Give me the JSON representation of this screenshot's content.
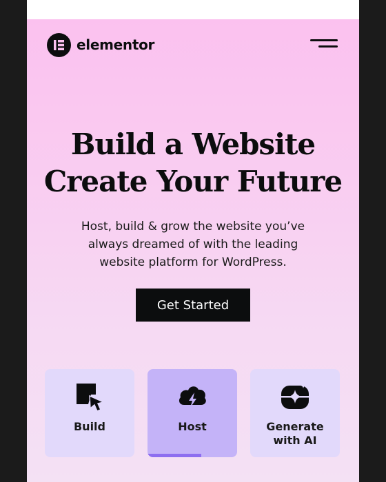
{
  "brand": {
    "name": "elementor",
    "logo_icon": "elementor-e-icon",
    "colors": {
      "hero_gradient_top": "#fbc1ef",
      "hero_gradient_bottom": "#f4e1f4",
      "card": "#e2d9fb",
      "card_active": "#c4b3f8",
      "progress": "#8d6ef0",
      "ink": "#0c0d0e"
    }
  },
  "header": {
    "menu_icon": "hamburger-menu-icon"
  },
  "hero": {
    "headline_line1": "Build a Website",
    "headline_line2": "Create Your Future",
    "subtext": "Host, build & grow the website you’ve always dreamed of with the leading website platform for WordPress.",
    "cta_label": "Get Started"
  },
  "features": [
    {
      "label": "Build",
      "icon": "build-cursor-icon",
      "active": false
    },
    {
      "label": "Host",
      "icon": "cloud-lightning-icon",
      "active": true,
      "progress": 0.6
    },
    {
      "label": "Generate with AI",
      "icon": "ai-sparkle-icon",
      "active": false
    }
  ]
}
